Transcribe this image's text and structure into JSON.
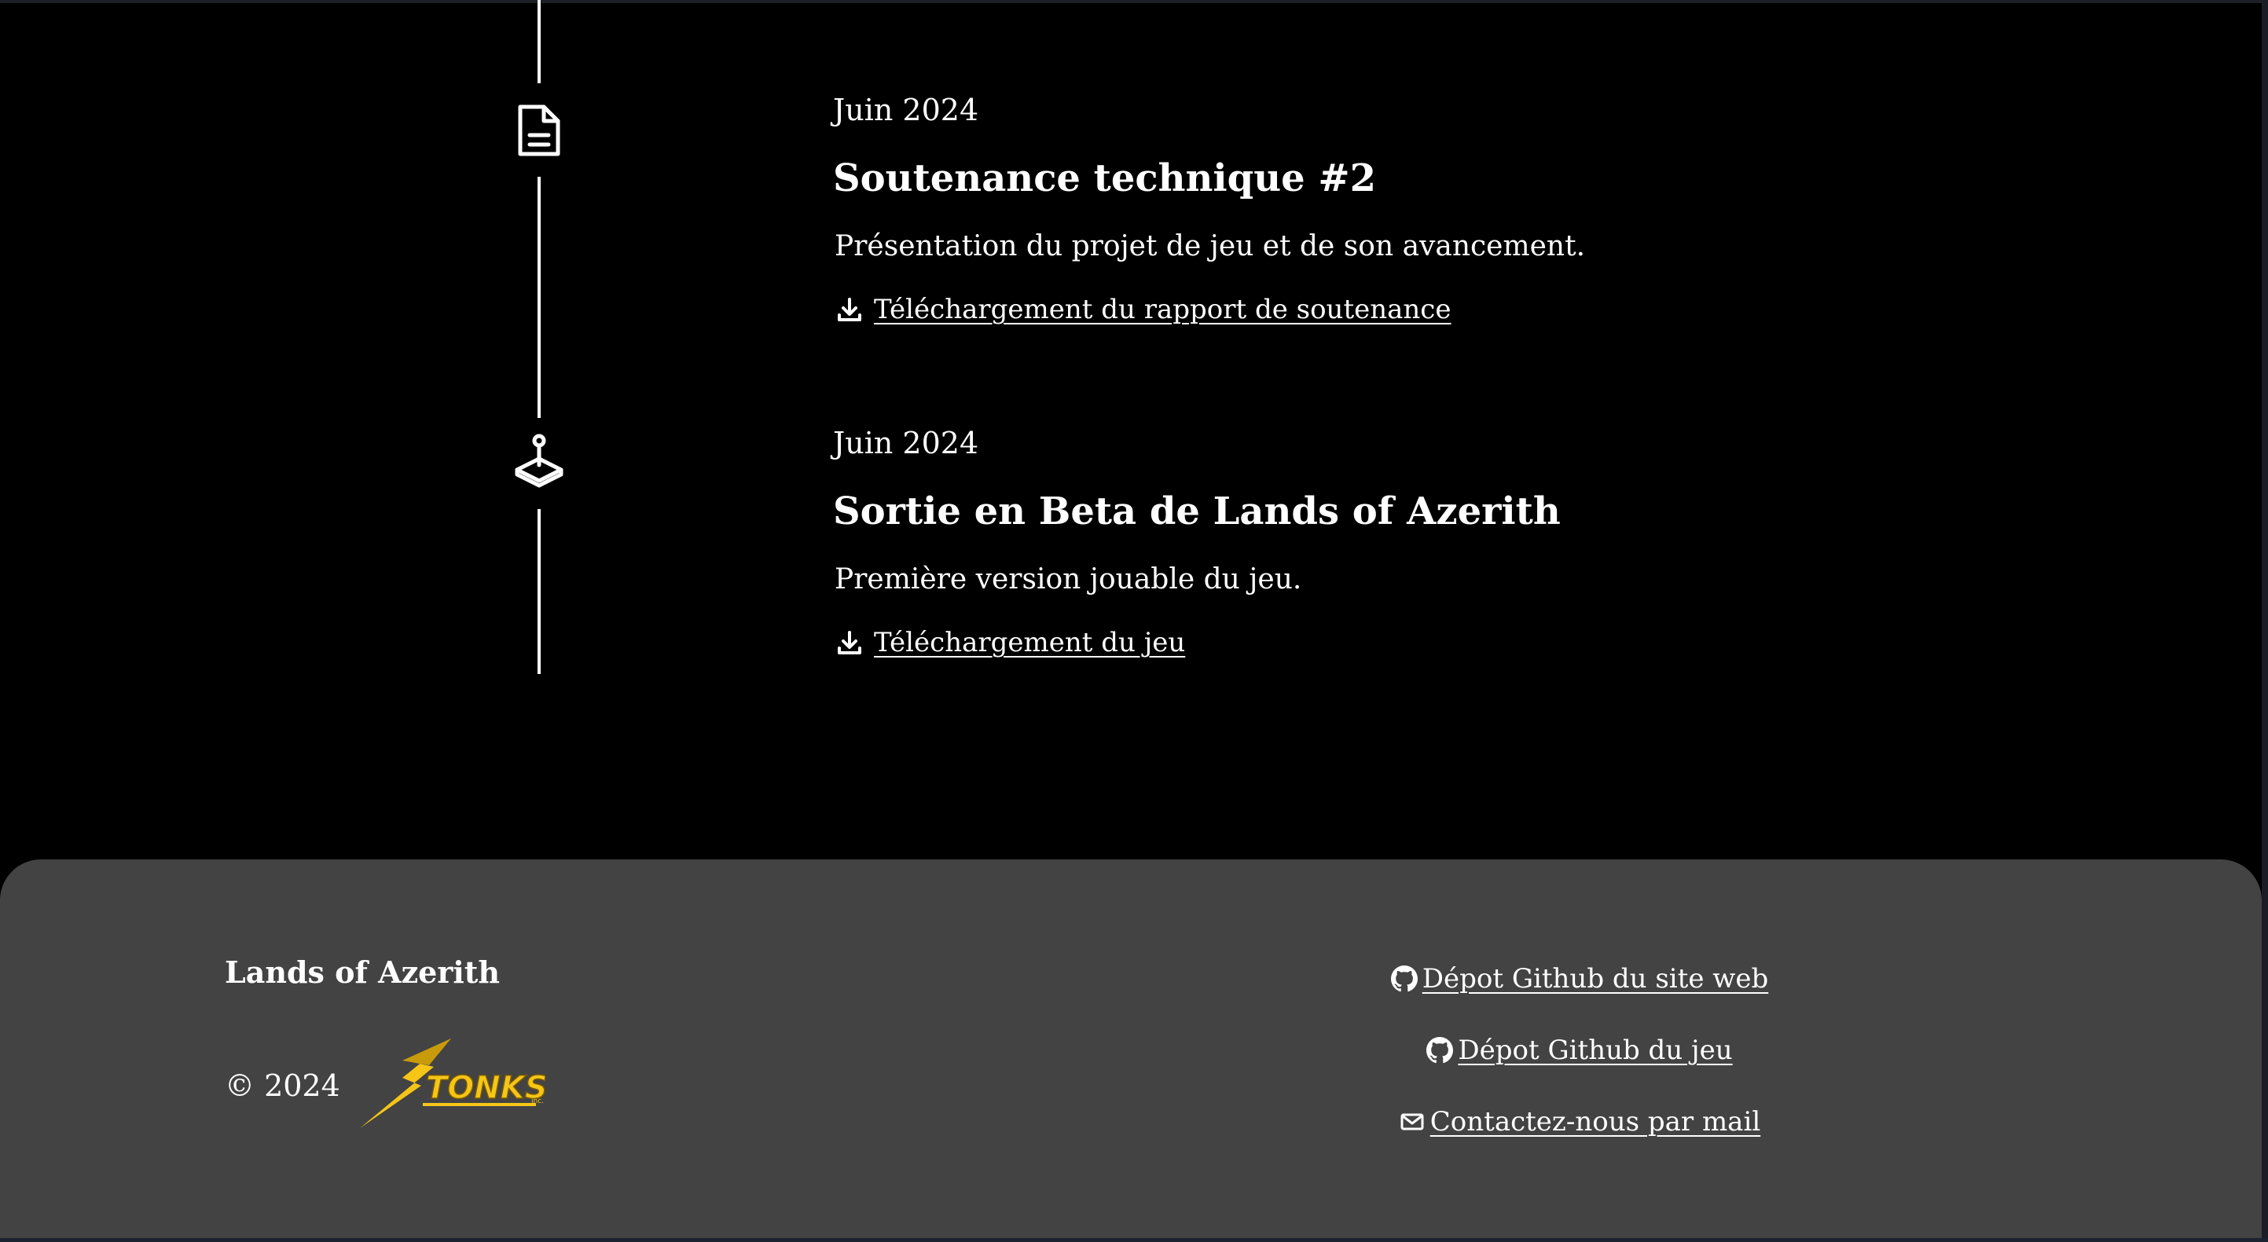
{
  "timeline": {
    "entries": [
      {
        "icon": "document-icon",
        "date": "Juin 2024",
        "title": "Soutenance technique #2",
        "description": "Présentation du projet de jeu et de son avancement.",
        "link_label": "Téléchargement du rapport de soutenance",
        "link_icon": "download-icon"
      },
      {
        "icon": "joystick-icon",
        "date": "Juin 2024",
        "title": "Sortie en Beta de Lands of Azerith",
        "description": "Première version jouable du jeu.",
        "link_label": "Téléchargement du jeu",
        "link_icon": "download-icon"
      }
    ]
  },
  "footer": {
    "title": "Lands of Azerith",
    "copyright": "© 2024",
    "logo_text": "TONKS",
    "logo_suffix": "inc.",
    "links": [
      {
        "icon": "github-icon",
        "label": "Dépot Github du site web"
      },
      {
        "icon": "github-icon",
        "label": "Dépot Github du jeu"
      },
      {
        "icon": "mail-icon",
        "label": "Contactez-nous par mail"
      }
    ]
  },
  "colors": {
    "background": "#000000",
    "footer_background": "#434343",
    "text": "#ffffff",
    "logo_yellow": "#f5c518"
  }
}
